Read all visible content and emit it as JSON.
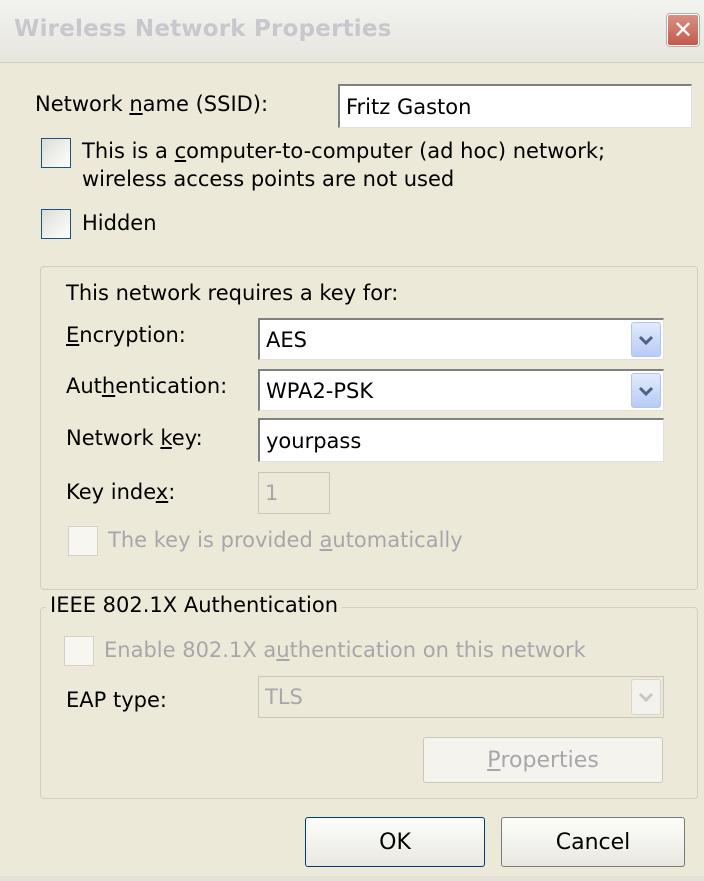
{
  "window": {
    "title": "Wireless Network Properties",
    "close_glyph": "✕"
  },
  "ssid": {
    "label_pre": "Network ",
    "label_u": "n",
    "label_post": "ame (SSID):",
    "value": "Fritz Gaston"
  },
  "adhoc": {
    "line1_pre": "This is a ",
    "line1_u": "c",
    "line1_post": "omputer-to-computer (ad hoc) network;",
    "line2": "wireless access points are not used",
    "checked": false
  },
  "hidden": {
    "label": "Hidden",
    "checked": false
  },
  "key_group": {
    "heading": "This network requires a key for:",
    "encryption": {
      "label_u": "E",
      "label_post": "ncryption:",
      "value": "AES"
    },
    "authentication": {
      "label_pre": "Aut",
      "label_u": "h",
      "label_post": "entication:",
      "value": "WPA2-PSK"
    },
    "network_key": {
      "label_pre": "Network ",
      "label_u": "k",
      "label_post": "ey:",
      "value": "yourpass"
    },
    "key_index": {
      "label_pre": "Key inde",
      "label_u": "x",
      "label_post": ":",
      "value": "1"
    },
    "auto_key": {
      "label_pre": "The key is provided ",
      "label_u": "a",
      "label_post": "utomatically",
      "checked": false
    }
  },
  "ieee_group": {
    "legend": "IEEE 802.1X Authentication",
    "enable": {
      "label_pre": "Enable 802.1X a",
      "label_u": "u",
      "label_post": "thentication on this network",
      "checked": false
    },
    "eap": {
      "label": "EAP type:",
      "value": "TLS"
    },
    "properties_button": {
      "label_u": "P",
      "label_post": "roperties"
    }
  },
  "buttons": {
    "ok": "OK",
    "cancel": "Cancel"
  },
  "icons": {
    "close": "close-icon",
    "dropdown": "chevron-down-icon"
  },
  "colors": {
    "window_bg": "#ece9d8",
    "close_button": "#c45a4c",
    "checkbox_border": "#1c5180",
    "disabled_text": "#a7a6aa"
  }
}
